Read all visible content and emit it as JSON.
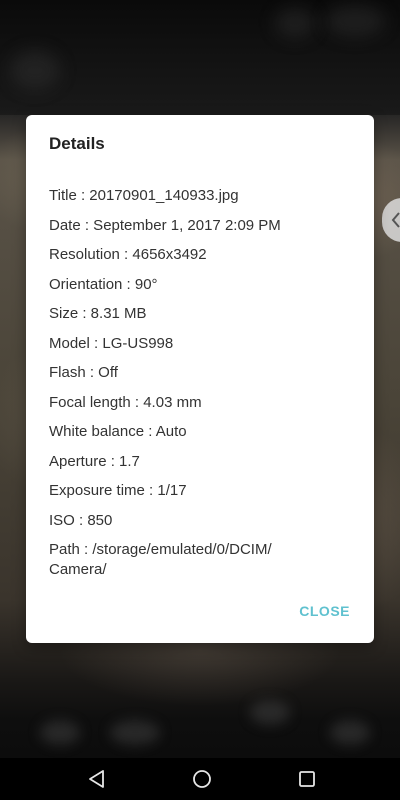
{
  "dialog": {
    "title": "Details",
    "rows": [
      "Title : 20170901_140933.jpg",
      "Date : September 1, 2017 2:09 PM",
      "Resolution : 4656x3492",
      "Orientation : 90°",
      "Size : 8.31 MB",
      "Model : LG-US998",
      "Flash : Off",
      "Focal length : 4.03 mm",
      "White balance : Auto",
      "Aperture : 1.7",
      "Exposure time : 1/17",
      "ISO : 850",
      "Path : /storage/emulated/0/DCIM/\nCamera/"
    ],
    "close_label": "CLOSE"
  },
  "side_tab": {
    "icon": "chevron-left-icon"
  },
  "nav_bar": {
    "back_icon": "back-triangle-icon",
    "home_icon": "home-circle-icon",
    "recents_icon": "recents-square-icon"
  },
  "colors": {
    "accent": "#5fc1cf",
    "dialog_bg": "#ffffff",
    "text": "#333333",
    "nav_bg": "#000000"
  }
}
